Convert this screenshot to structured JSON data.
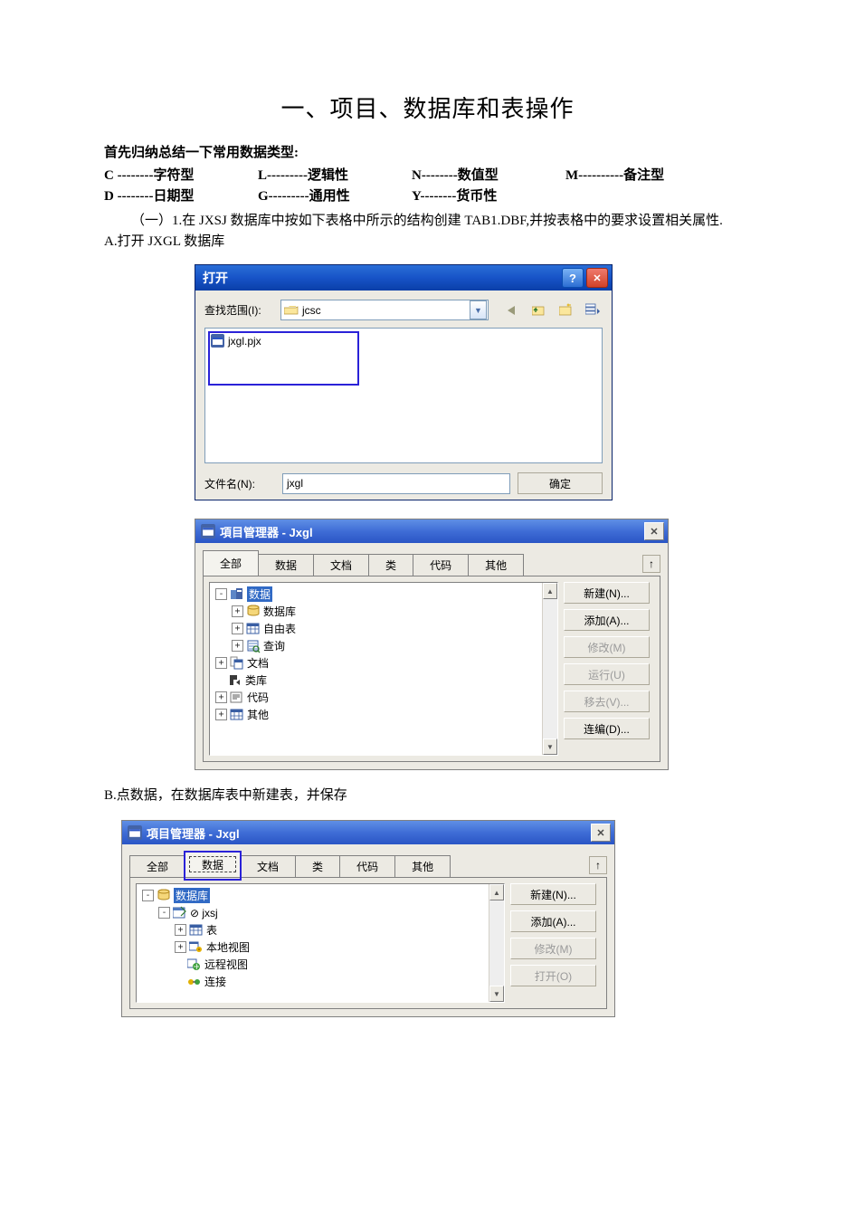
{
  "document": {
    "title": "一、项目、数据库和表操作",
    "intro_label": "首先归纳总结一下常用数据类型:",
    "type_rows": [
      [
        "C --------字符型",
        "L---------逻辑性",
        "N--------数值型",
        "M----------备注型"
      ],
      [
        "D --------日期型",
        "G---------通用性",
        "Y--------货币性",
        ""
      ]
    ],
    "para_1": "（一）1.在 JXSJ 数据库中按如下表格中所示的结构创建 TAB1.DBF,并按表格中的要求设置相关属性.",
    "para_2": "A.打开 JXGL 数据库",
    "para_3": "B.点数据，在数据库表中新建表，并保存"
  },
  "open_dialog": {
    "title": "打开",
    "lookin_label": "查找范围(I):",
    "folder_name": "jcsc",
    "file_item": "jxgl.pjx",
    "filename_label": "文件名(N):",
    "filename_value": "jxgl",
    "ok_label": "确定"
  },
  "project_manager_1": {
    "title": "項目管理器 - Jxgl",
    "tabs": [
      "全部",
      "数据",
      "文档",
      "类",
      "代码",
      "其他"
    ],
    "active_tab_index": 0,
    "expand_button": "↑",
    "tree": [
      {
        "indent": 0,
        "exp": "-",
        "icon": "data",
        "label": "数据",
        "selected": true
      },
      {
        "indent": 1,
        "exp": "+",
        "icon": "db",
        "label": "数据库"
      },
      {
        "indent": 1,
        "exp": "+",
        "icon": "table",
        "label": "自由表"
      },
      {
        "indent": 1,
        "exp": "+",
        "icon": "query",
        "label": "查询"
      },
      {
        "indent": 0,
        "exp": "+",
        "icon": "doc",
        "label": "文档"
      },
      {
        "indent": 0,
        "exp": " ",
        "icon": "class",
        "label": "类库"
      },
      {
        "indent": 0,
        "exp": "+",
        "icon": "code",
        "label": "代码"
      },
      {
        "indent": 0,
        "exp": "+",
        "icon": "other",
        "label": "其他"
      }
    ],
    "buttons": [
      {
        "label": "新建(N)...",
        "disabled": false
      },
      {
        "label": "添加(A)...",
        "disabled": false
      },
      {
        "label": "修改(M)",
        "disabled": true
      },
      {
        "label": "运行(U)",
        "disabled": true
      },
      {
        "label": "移去(V)...",
        "disabled": true
      },
      {
        "label": "连编(D)...",
        "disabled": false
      }
    ]
  },
  "project_manager_2": {
    "title": "項目管理器 - Jxgl",
    "tabs": [
      "全部",
      "数据",
      "文档",
      "类",
      "代码",
      "其他"
    ],
    "active_tab_index": 1,
    "expand_button": "↑",
    "tree": [
      {
        "indent": 0,
        "exp": "-",
        "icon": "db",
        "label": "数据库",
        "selected": true
      },
      {
        "indent": 1,
        "exp": "-",
        "icon": "open",
        "label": "⊘ jxsj"
      },
      {
        "indent": 2,
        "exp": "+",
        "icon": "table",
        "label": "表"
      },
      {
        "indent": 2,
        "exp": "+",
        "icon": "lview",
        "label": "本地视图"
      },
      {
        "indent": 2,
        "exp": " ",
        "icon": "rview",
        "label": "远程视图"
      },
      {
        "indent": 2,
        "exp": " ",
        "icon": "conn",
        "label": "连接"
      }
    ],
    "buttons": [
      {
        "label": "新建(N)...",
        "disabled": false
      },
      {
        "label": "添加(A)...",
        "disabled": false
      },
      {
        "label": "修改(M)",
        "disabled": true
      },
      {
        "label": "打开(O)",
        "disabled": true
      }
    ]
  }
}
